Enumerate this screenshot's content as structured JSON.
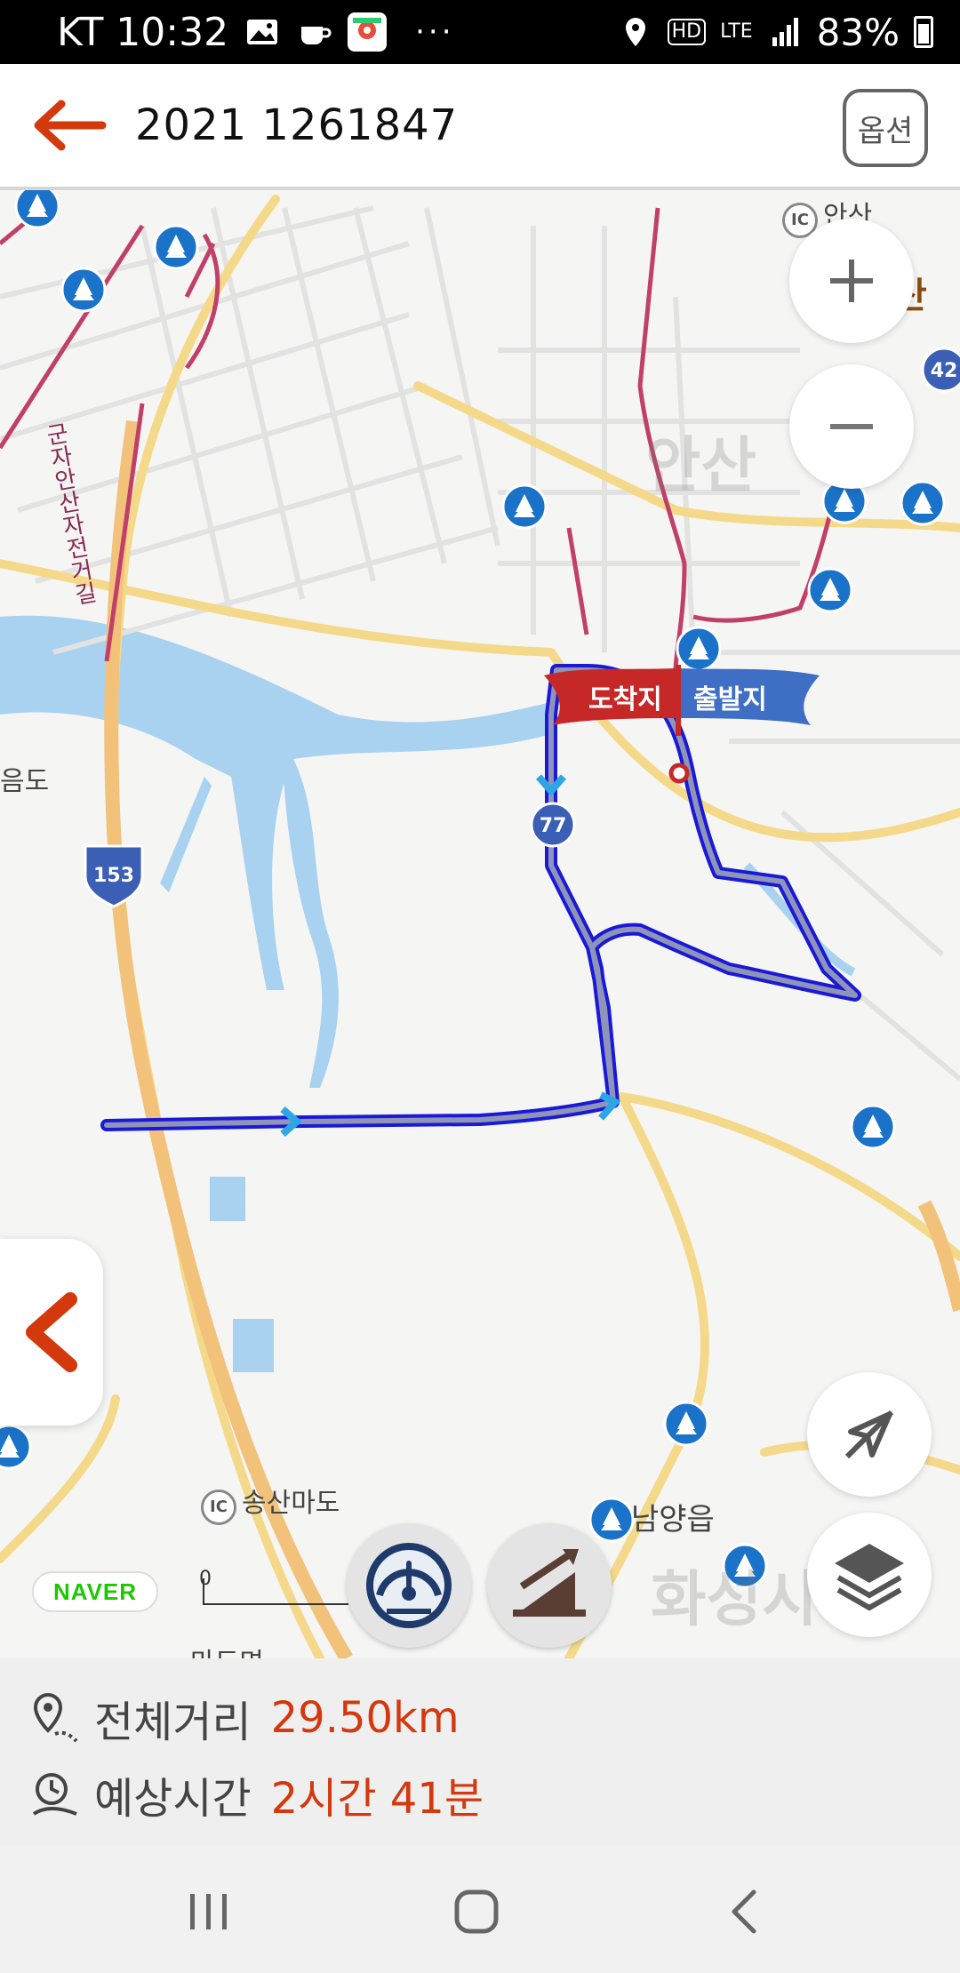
{
  "status_bar": {
    "carrier_time": "KT 10:32",
    "more": "···",
    "hd": "HD",
    "network": "LTE",
    "battery": "83%"
  },
  "header": {
    "title": "2021 1261847",
    "options_label": "옵션"
  },
  "map": {
    "labels": {
      "ansan_ic": "안산",
      "ansan_city": "안산",
      "ansan_right": "산",
      "road_name": "군자안산자전거길",
      "island": "음도",
      "songsan_ic": "송산마도",
      "namyang": "남양읍",
      "hwaseong": "화성시",
      "madoman": "마도면",
      "ic": "IC"
    },
    "route_shields": [
      "153",
      "77",
      "42"
    ],
    "flag": {
      "destination": "도착지",
      "origin": "출발지"
    },
    "scale_zero": "0",
    "naver_logo": "NAVER"
  },
  "route_summary": {
    "distance_label": "전체거리",
    "distance_value": "29.50km",
    "time_label": "예상시간",
    "time_value": "2시간 41분"
  },
  "colors": {
    "accent": "#d4380d",
    "route": "#1a1ad6",
    "flag_red": "#c62828",
    "flag_blue": "#3f6fc4",
    "water": "#a9d2f0"
  }
}
